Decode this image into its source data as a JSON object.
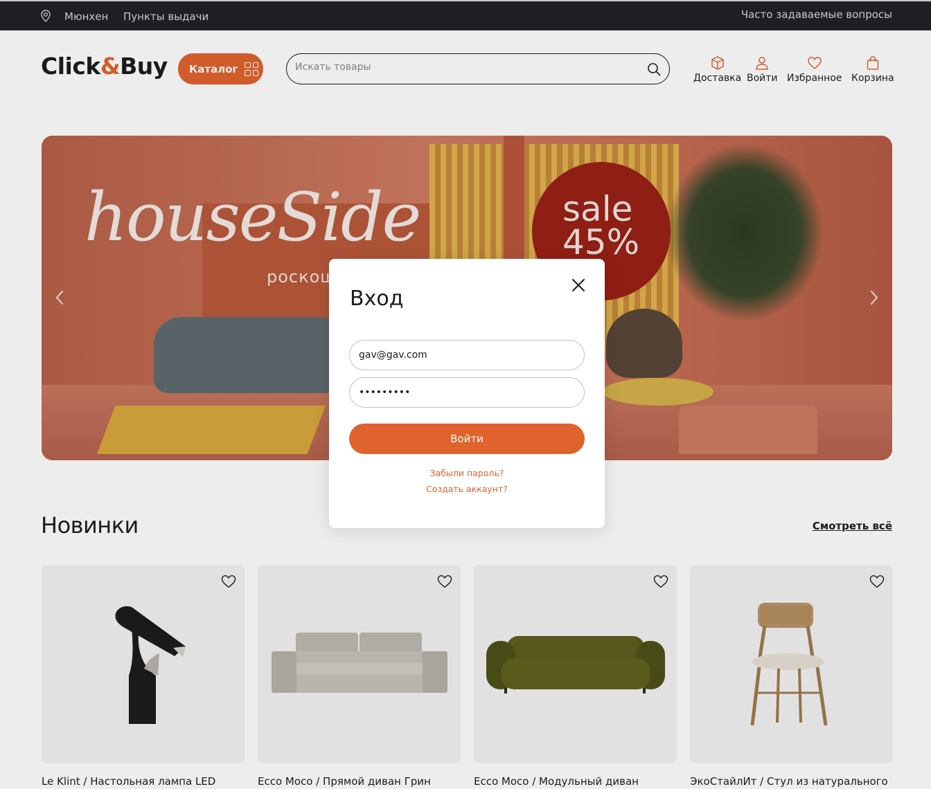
{
  "topbar": {
    "city": "Мюнхен",
    "pickup": "Пункты выдачи",
    "faq": "Часто задаваемые вопросы"
  },
  "header": {
    "logo_left": "Click",
    "logo_amp": "&",
    "logo_right": "Buy",
    "catalog": "Каталог",
    "search_placeholder": "Искать товары",
    "nav": [
      {
        "label": "Доставка",
        "icon": "box-icon"
      },
      {
        "label": "Войти",
        "icon": "user-icon"
      },
      {
        "label": "Избранное",
        "icon": "heart-icon"
      },
      {
        "label": "Корзина",
        "icon": "bag-icon"
      }
    ]
  },
  "banner": {
    "brand": "houseSide",
    "tagline": "роскош",
    "sale_line1": "sale",
    "sale_line2": "45%"
  },
  "section": {
    "title": "Новинки",
    "see_all": "Смотреть всё"
  },
  "products": [
    {
      "title": "Le Klint / Настольная лампа LED"
    },
    {
      "title": "Ecco Moco / Прямой диван Грин"
    },
    {
      "title": "Ecco Moco / Модульный диван"
    },
    {
      "title": "ЭкоСтайлИт / Стул из натурального"
    }
  ],
  "modal": {
    "title": "Вход",
    "email": "gav@gav.com",
    "password": "•••••••••",
    "submit": "Войти",
    "forgot": "Забыли пароль?",
    "create": "Создать аккаунт?"
  },
  "colors": {
    "accent": "#e0622d",
    "topbar": "#1f2023"
  }
}
